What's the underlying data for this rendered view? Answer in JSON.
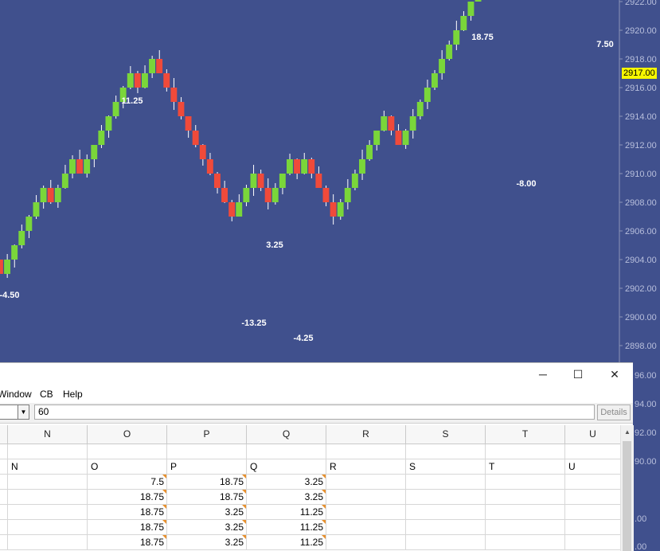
{
  "chart": {
    "current_price": "2917.00",
    "y_axis_ticks": [
      "2922.00",
      "2920.00",
      "2918.00",
      "2916.00",
      "2914.00",
      "2912.00",
      "2910.00",
      "2908.00",
      "2906.00",
      "2904.00",
      "2902.00",
      "2900.00",
      "2898.00"
    ],
    "right_axis_partial": [
      "96.00",
      "94.00",
      "92.00",
      "90.00",
      ".00",
      ".00"
    ],
    "swing_labels": [
      "-4.50",
      "11.25",
      "-13.25",
      "3.25",
      "-4.25",
      "18.75",
      "-8.00",
      "7.50"
    ],
    "colors": {
      "background": "#40508d",
      "up": "#7ad63a",
      "down": "#f04a3a",
      "price_tag": "#f6f600"
    }
  },
  "chart_data": {
    "type": "renko",
    "brick_size": 1,
    "y_range": [
      2897,
      2922.5
    ],
    "bricks": [
      "down",
      "up",
      "up",
      "up",
      "up",
      "up",
      "up",
      "down",
      "up",
      "up",
      "up",
      "down",
      "up",
      "up",
      "up",
      "up",
      "up",
      "up",
      "up",
      "down",
      "up",
      "up",
      "down",
      "down",
      "down",
      "down",
      "down",
      "down",
      "down",
      "down",
      "down",
      "down",
      "down",
      "up",
      "up",
      "up",
      "down",
      "down",
      "up",
      "up",
      "up",
      "down",
      "up",
      "down",
      "down",
      "down",
      "down",
      "up",
      "up",
      "up",
      "up",
      "up",
      "up",
      "up",
      "down",
      "down",
      "up",
      "up",
      "up",
      "up",
      "up",
      "up",
      "up",
      "up",
      "up",
      "up",
      "up",
      "up",
      "up",
      "up",
      "up",
      "up",
      "up",
      "down",
      "down",
      "down",
      "down",
      "down",
      "down",
      "up",
      "up",
      "up",
      "up",
      "up",
      "down",
      "up",
      "up",
      "up",
      "down",
      "up",
      "up",
      "up",
      "up",
      "down"
    ],
    "swing_annotations": [
      {
        "label": "-4.50",
        "type": "low"
      },
      {
        "label": "11.25",
        "type": "high"
      },
      {
        "label": "-13.25",
        "type": "low"
      },
      {
        "label": "3.25",
        "type": "high"
      },
      {
        "label": "-4.25",
        "type": "low"
      },
      {
        "label": "18.75",
        "type": "high"
      },
      {
        "label": "-8.00",
        "type": "low"
      },
      {
        "label": "7.50",
        "type": "high"
      }
    ],
    "last_price": 2917.0
  },
  "spreadsheet": {
    "menu": [
      "Window",
      "CB",
      "Help"
    ],
    "formula_value": "60",
    "details_label": "Details",
    "column_headers": [
      "N",
      "O",
      "P",
      "Q",
      "R",
      "S",
      "T",
      "U"
    ],
    "header_row": [
      "N",
      "O",
      "P",
      "Q",
      "R",
      "S",
      "T",
      "U"
    ],
    "rows": [
      [
        "",
        "7.5",
        "18.75",
        "3.25",
        "",
        "",
        "",
        ""
      ],
      [
        "",
        "18.75",
        "18.75",
        "3.25",
        "",
        "",
        "",
        ""
      ],
      [
        "",
        "18.75",
        "3.25",
        "11.25",
        "",
        "",
        "",
        ""
      ],
      [
        "",
        "18.75",
        "3.25",
        "11.25",
        "",
        "",
        "",
        ""
      ],
      [
        "",
        "18.75",
        "3.25",
        "11.25",
        "",
        "",
        "",
        ""
      ]
    ],
    "window_buttons": {
      "minimize": "─",
      "maximize": "☐",
      "close": "✕"
    }
  }
}
